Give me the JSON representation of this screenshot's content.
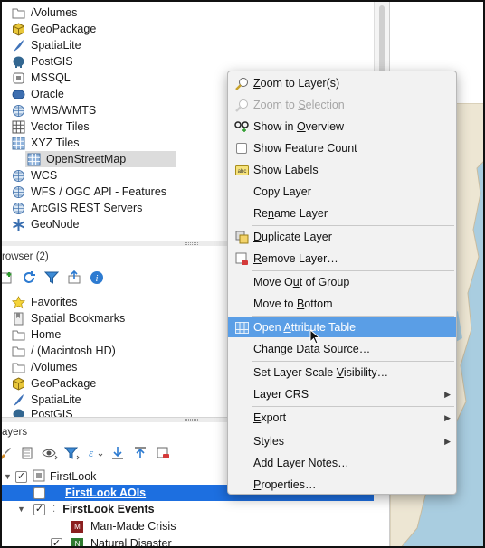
{
  "browser_top": {
    "items": [
      {
        "label": "/Volumes",
        "icon": "folder-icon"
      },
      {
        "label": "GeoPackage",
        "icon": "geopackage-icon"
      },
      {
        "label": "SpatiaLite",
        "icon": "spatialite-feather-icon"
      },
      {
        "label": "PostGIS",
        "icon": "postgis-elephant-icon"
      },
      {
        "label": "MSSQL",
        "icon": "mssql-icon"
      },
      {
        "label": "Oracle",
        "icon": "oracle-icon"
      },
      {
        "label": "WMS/WMTS",
        "icon": "globe-icon"
      },
      {
        "label": "Vector Tiles",
        "icon": "grid-tiles-icon"
      },
      {
        "label": "XYZ Tiles",
        "icon": "grid-tiles-icon"
      },
      {
        "label": "OpenStreetMap",
        "icon": "grid-tiles-icon"
      },
      {
        "label": "WCS",
        "icon": "globe-icon"
      },
      {
        "label": "WFS / OGC API - Features",
        "icon": "globe-icon"
      },
      {
        "label": "ArcGIS REST Servers",
        "icon": "globe-icon"
      },
      {
        "label": "GeoNode",
        "icon": "geonode-icon"
      }
    ]
  },
  "browser2": {
    "title": "rowser (2)",
    "items": [
      {
        "label": "Favorites",
        "icon": "star-icon"
      },
      {
        "label": "Spatial Bookmarks",
        "icon": "bookmark-icon"
      },
      {
        "label": "Home",
        "icon": "home-folder-icon"
      },
      {
        "label": "/ (Macintosh HD)",
        "icon": "folder-icon"
      },
      {
        "label": "/Volumes",
        "icon": "folder-icon"
      },
      {
        "label": "GeoPackage",
        "icon": "geopackage-icon"
      },
      {
        "label": "SpatiaLite",
        "icon": "spatialite-feather-icon"
      },
      {
        "label": "PostGIS",
        "icon": "postgis-elephant-icon"
      }
    ]
  },
  "layers": {
    "title": "ayers",
    "group": "FirstLook",
    "selected_layer": "FirstLook AOIs",
    "events_group": "FirstLook Events",
    "sub1": "Man-Made Crisis",
    "sub2": "Natural Disaster",
    "check": "✓"
  },
  "menu": {
    "items": [
      {
        "label_pre": "",
        "u": "Z",
        "label_post": "oom to Layer(s)",
        "icon": "zoom-layer-icon",
        "disabled": false
      },
      {
        "label_pre": "Zoom to ",
        "u": "S",
        "label_post": "election",
        "icon": "zoom-selection-icon",
        "disabled": true
      },
      {
        "label_pre": "Show in ",
        "u": "O",
        "label_post": "verview",
        "icon": "overview-glasses-icon",
        "disabled": false
      },
      {
        "label_pre": "Show Feature Count",
        "u": "",
        "label_post": "",
        "icon": "checkbox-icon",
        "disabled": false
      },
      {
        "label_pre": "Show ",
        "u": "L",
        "label_post": "abels",
        "icon": "labels-abc-icon",
        "disabled": false
      },
      {
        "label_pre": "Copy Layer",
        "u": "",
        "label_post": "",
        "icon": "",
        "disabled": false
      },
      {
        "label_pre": "Re",
        "u": "n",
        "label_post": "ame Layer",
        "icon": "",
        "disabled": false
      },
      {
        "label_pre": "",
        "u": "D",
        "label_post": "uplicate Layer",
        "icon": "duplicate-layer-icon",
        "disabled": false
      },
      {
        "label_pre": "",
        "u": "R",
        "label_post": "emove Layer…",
        "icon": "remove-layer-icon",
        "disabled": false
      },
      {
        "label_pre": "Move O",
        "u": "u",
        "label_post": "t of Group",
        "icon": "",
        "disabled": false
      },
      {
        "label_pre": "Move to ",
        "u": "B",
        "label_post": "ottom",
        "icon": "",
        "disabled": false
      },
      {
        "label_pre": "Open ",
        "u": "A",
        "label_post": "ttribute Table",
        "icon": "table-icon",
        "disabled": false
      },
      {
        "label_pre": "Change Data Source",
        "u": "",
        "label_post": "…",
        "icon": "",
        "disabled": false
      },
      {
        "label_pre": "Set Layer Scale ",
        "u": "V",
        "label_post": "isibility…",
        "icon": "",
        "disabled": false
      },
      {
        "label_pre": "Layer CRS",
        "u": "",
        "label_post": "",
        "icon": "",
        "disabled": false,
        "submenu": true
      },
      {
        "label_pre": "",
        "u": "E",
        "label_post": "xport",
        "icon": "",
        "disabled": false,
        "submenu": true
      },
      {
        "label_pre": "Styles",
        "u": "",
        "label_post": "",
        "icon": "",
        "disabled": false,
        "submenu": true
      },
      {
        "label_pre": "Add Layer Notes…",
        "u": "",
        "label_post": "",
        "icon": "",
        "disabled": false
      },
      {
        "label_pre": "",
        "u": "P",
        "label_post": "roperties…",
        "icon": "",
        "disabled": false
      }
    ],
    "highlight_color": "#5a9ee6",
    "submenu_arrow": "▶"
  },
  "colors": {
    "selection": "#1d6fe0",
    "map_sea": "#a9cde0"
  }
}
